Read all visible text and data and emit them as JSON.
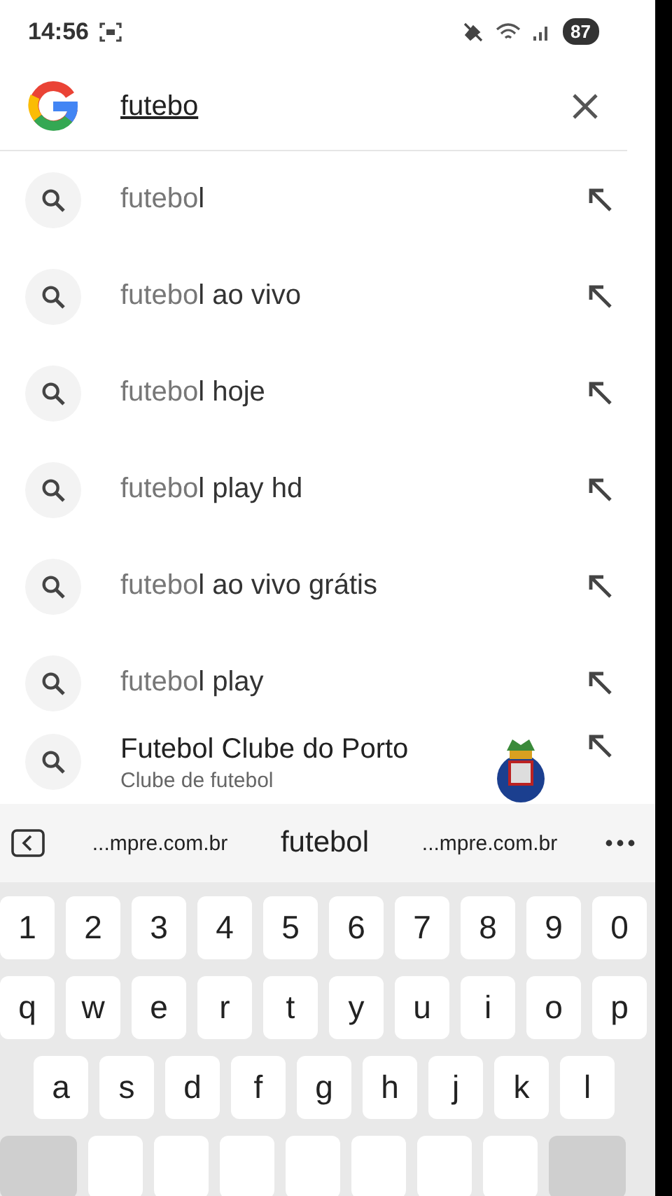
{
  "status_bar": {
    "time": "14:56",
    "battery": "87"
  },
  "search": {
    "value": "futebo"
  },
  "suggestions": [
    {
      "kind": "query",
      "text": "futebo**l**"
    },
    {
      "kind": "query",
      "text": "futebo**l ao vivo**"
    },
    {
      "kind": "query",
      "text": "futebo**l hoje**"
    },
    {
      "kind": "query",
      "text": "futebo**l play hd**"
    },
    {
      "kind": "query",
      "text": "futebo**l ao vivo grátis**"
    },
    {
      "kind": "query",
      "text": "futebo**l play**"
    },
    {
      "kind": "entity",
      "text": "Futebol Clube do Porto",
      "subtitle": "Clube de futebol"
    }
  ],
  "keyboard": {
    "candidates": [
      {
        "text": "...mpre.com.br",
        "selected": false
      },
      {
        "text": "futebol",
        "selected": true
      },
      {
        "text": "...mpre.com.br",
        "selected": false
      }
    ],
    "rows": [
      [
        "1",
        "2",
        "3",
        "4",
        "5",
        "6",
        "7",
        "8",
        "9",
        "0"
      ],
      [
        "q",
        "w",
        "e",
        "r",
        "t",
        "y",
        "u",
        "i",
        "o",
        "p"
      ],
      [
        "a",
        "s",
        "d",
        "f",
        "g",
        "h",
        "j",
        "k",
        "l"
      ]
    ]
  }
}
